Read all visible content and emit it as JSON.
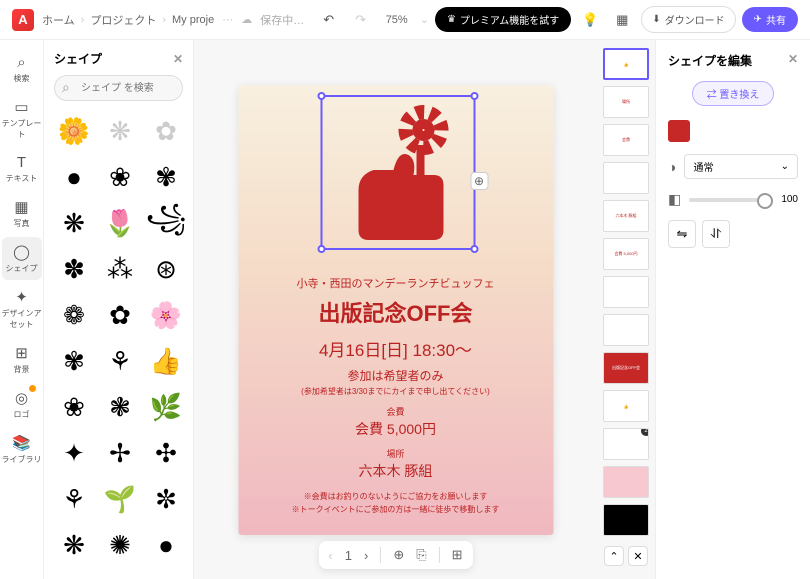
{
  "topbar": {
    "home": "ホーム",
    "projects": "プロジェクト",
    "project_name": "My proje",
    "saving": "保存中…",
    "zoom": "75%",
    "premium": "プレミアム機能を試す",
    "download": "ダウンロード",
    "share": "共有"
  },
  "rail": {
    "items": [
      {
        "label": "検索",
        "icon": "⌕"
      },
      {
        "label": "テンプレート",
        "icon": "▭"
      },
      {
        "label": "テキスト",
        "icon": "T"
      },
      {
        "label": "写真",
        "icon": "▦"
      },
      {
        "label": "シェイプ",
        "icon": "◯"
      },
      {
        "label": "デザインアセット",
        "icon": "✦"
      },
      {
        "label": "背景",
        "icon": "⊞"
      },
      {
        "label": "ロゴ",
        "icon": "◎"
      },
      {
        "label": "ライブラリ",
        "icon": "📚"
      }
    ]
  },
  "shapes_panel": {
    "title": "シェイプ",
    "search_placeholder": "シェイプ を検索"
  },
  "poster": {
    "line1": "小寺・西田のマンデーランチビュッフェ",
    "title": "出版記念OFF会",
    "date": "4月16日[日] 18:30〜",
    "sub": "参加は希望者のみ",
    "fine": "(参加希望者は3/30までにカイまで申し出てください)",
    "fee_label": "会費",
    "fee": "会費 5,000円",
    "place_label": "場所",
    "place": "六本木 豚組",
    "note1": "※会費はお釣りのないようにご協力をお願いします",
    "note2": "※トークイベントにご参加の方は一緒に徒歩で移動します"
  },
  "pages": {
    "thumbs": [
      "",
      "場所",
      "会費",
      "",
      "六本木 豚組",
      "会費 5,000円",
      "",
      "",
      "出版記念OFF会",
      "",
      "",
      ""
    ],
    "current": "1"
  },
  "right_panel": {
    "title": "シェイプを編集",
    "replace": "置き換え",
    "blend": "通常",
    "opacity": "100"
  }
}
